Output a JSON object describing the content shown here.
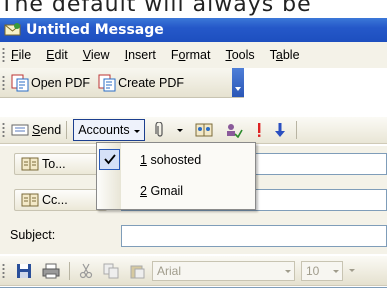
{
  "caption": "The default will always be",
  "window": {
    "title": "Untitled Message",
    "icon": "envelope-icon"
  },
  "menubar": {
    "items": [
      {
        "label": "File",
        "mnemonic": "F",
        "rest": "ile"
      },
      {
        "label": "Edit",
        "mnemonic": "E",
        "rest": "dit"
      },
      {
        "label": "View",
        "mnemonic": "V",
        "rest": "iew"
      },
      {
        "label": "Insert",
        "mnemonic": "I",
        "rest": "nsert"
      },
      {
        "label": "Format",
        "mnemonic": "o",
        "pre": "F",
        "rest": "rmat"
      },
      {
        "label": "Tools",
        "mnemonic": "T",
        "rest": "ools"
      },
      {
        "label": "Table",
        "mnemonic": "a",
        "pre": "T",
        "rest": "ble"
      }
    ]
  },
  "pdf_toolbar": {
    "open_pdf": "Open PDF",
    "create_pdf": "Create PDF"
  },
  "mail_toolbar": {
    "send_label": "Send",
    "send_mnemonic": "S",
    "send_rest": "end",
    "accounts_label": "Accounts"
  },
  "accounts_menu": {
    "items": [
      {
        "number": "1",
        "name": "sohosted",
        "checked": true
      },
      {
        "number": "2",
        "name": "Gmail",
        "checked": false
      }
    ]
  },
  "header": {
    "to_label": "To...",
    "cc_label": "Cc...",
    "subject_label": "Subject:"
  },
  "format_toolbar": {
    "font": "Arial",
    "size": "10"
  },
  "colors": {
    "titlebar": "#2558c9",
    "menubar_bg": "#f4f2e8",
    "selection_border": "#1c3f8f"
  }
}
